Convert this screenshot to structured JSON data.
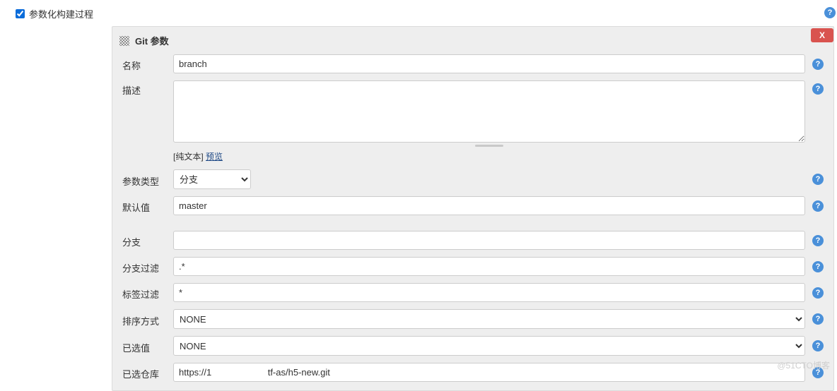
{
  "top": {
    "checkbox_label": "参数化构建过程",
    "checked": true
  },
  "panel": {
    "title": "Git 参数",
    "close_label": "X"
  },
  "fields": {
    "name": {
      "label": "名称",
      "value": "branch"
    },
    "description": {
      "label": "描述",
      "value": "",
      "plain_text_prefix": "[纯文本] ",
      "preview_link": "预览"
    },
    "param_type": {
      "label": "参数类型",
      "value": "分支"
    },
    "default_val": {
      "label": "默认值",
      "value": "master"
    },
    "branch": {
      "label": "分支",
      "value": ""
    },
    "branch_filter": {
      "label": "分支过滤",
      "value": ".*"
    },
    "tag_filter": {
      "label": "标签过滤",
      "value": "*"
    },
    "sort": {
      "label": "排序方式",
      "value": "NONE"
    },
    "selected": {
      "label": "已选值",
      "value": "NONE"
    },
    "repo": {
      "label": "已选仓库",
      "value": "https://1                      tf-as/h5-new.git"
    }
  },
  "help_glyph": "?",
  "watermark": "@51CTO博客"
}
